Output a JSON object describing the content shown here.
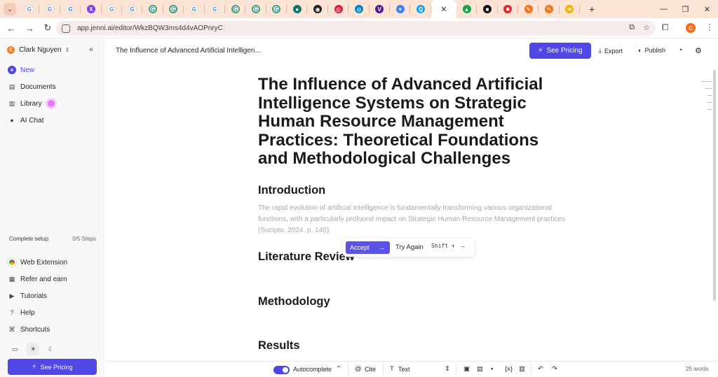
{
  "browser": {
    "tab_menu_glyph": "⌄",
    "tabs": [
      {
        "icon": "google-icon",
        "glyph": "G"
      },
      {
        "icon": "google-icon",
        "glyph": "G"
      },
      {
        "icon": "google-icon",
        "glyph": "G"
      },
      {
        "icon": "purple-x-icon",
        "glyph": "X",
        "color": "#7c3aed"
      },
      {
        "icon": "google-icon",
        "glyph": "G"
      },
      {
        "icon": "google-icon",
        "glyph": "G"
      },
      {
        "icon": "google-ring-icon",
        "glyph": "G"
      },
      {
        "icon": "google-ring-icon",
        "glyph": "G"
      },
      {
        "icon": "google-icon",
        "glyph": "G"
      },
      {
        "icon": "google-icon",
        "glyph": "G"
      },
      {
        "icon": "google-ring-icon",
        "glyph": "G"
      },
      {
        "icon": "google-ring-icon",
        "glyph": "G"
      },
      {
        "icon": "google-ring-icon",
        "glyph": "G"
      },
      {
        "icon": "teal-app-icon",
        "glyph": "●",
        "color": "#0f766e"
      },
      {
        "icon": "dark-app-icon",
        "glyph": "◉",
        "color": "#222222"
      },
      {
        "icon": "pink-app-icon",
        "glyph": "◎",
        "color": "#e11d48"
      },
      {
        "icon": "blue-ring-icon",
        "glyph": "◎",
        "color": "#0284c7"
      },
      {
        "icon": "v-app-icon",
        "glyph": "V",
        "color": "#4c1d95"
      },
      {
        "icon": "jenni-icon",
        "glyph": "✦",
        "color": "#3b82f6"
      },
      {
        "icon": "q-app-icon",
        "glyph": "Q",
        "color": "#0ea5e9"
      }
    ],
    "active_tab_close": "✕",
    "tabs_after": [
      {
        "icon": "green-app-icon",
        "glyph": "▲",
        "color": "#16a34a"
      },
      {
        "icon": "black-square-icon",
        "glyph": "■",
        "color": "#111111"
      },
      {
        "icon": "red-burst-icon",
        "glyph": "✹",
        "color": "#dc2626"
      },
      {
        "icon": "orange-app-icon",
        "glyph": "✎",
        "color": "#f97316"
      },
      {
        "icon": "orange-app-icon",
        "glyph": "✎",
        "color": "#f97316"
      },
      {
        "icon": "yellow-app-icon",
        "glyph": "✉",
        "color": "#eab308"
      }
    ],
    "new_tab_glyph": "+",
    "window_controls": [
      "—",
      "❐",
      "✕"
    ],
    "url": "app.jenni.ai/editor/WkzBQW3ms4d4vAOPnryC",
    "avatar_letter": "C"
  },
  "sidebar": {
    "user_name": "Clark Nguyen",
    "user_initial": "C",
    "collapse_glyph": "«",
    "items": [
      {
        "label": "New",
        "icon": "plus-circle-icon",
        "glyph": "+"
      },
      {
        "label": "Documents",
        "icon": "document-icon",
        "glyph": "▤"
      },
      {
        "label": "Library",
        "icon": "library-icon",
        "glyph": "▥"
      },
      {
        "label": "AI Chat",
        "icon": "chat-bubble-icon",
        "glyph": "●"
      }
    ],
    "setup": {
      "label": "Complete setup",
      "steps": "0/5 Steps"
    },
    "lower_items": [
      {
        "label": "Web Extension",
        "icon": "chrome-icon",
        "glyph": ""
      },
      {
        "label": "Refer and earn",
        "icon": "gift-icon",
        "glyph": "▦"
      },
      {
        "label": "Tutorials",
        "icon": "video-icon",
        "glyph": "▶"
      },
      {
        "label": "Help",
        "icon": "help-circle-icon",
        "glyph": "?"
      },
      {
        "label": "Shortcuts",
        "icon": "command-icon",
        "glyph": "⌘"
      }
    ],
    "theme_glyphs": {
      "monitor": "▭",
      "sun": "☀",
      "moon": "☾"
    },
    "pricing_label": "See Pricing",
    "pricing_glyph": "⚡"
  },
  "toolbar": {
    "doc_title": "The Influence of Advanced Artificial Intelligen...",
    "pricing_label": "See Pricing",
    "pricing_glyph": "⚡",
    "export_label": "Export",
    "export_glyph": "⤓",
    "publish_label": "Publish",
    "publish_glyph": "◐",
    "history_glyph": "◔",
    "settings_glyph": "⚙"
  },
  "document": {
    "title": "The Influence of Advanced Artificial Intelligence Systems on Strategic Human Resource Management Practices: Theoretical Foundations and Methodological Challenges",
    "headings": [
      "Introduction",
      "Literature Review",
      "Methodology",
      "Results"
    ],
    "suggestion": "The rapid evolution of artificial intelligence is fundamentally transforming various organizational functions, with a particularly profound impact on Strategic Human Resource Management practices (Sucipto, 2024, p. 140)."
  },
  "suggestion_bar": {
    "accept_label": "Accept",
    "accept_glyph": "→",
    "try_again_label": "Try Again",
    "shortcut": "Shift +",
    "shortcut_glyph": "→"
  },
  "bottom_bar": {
    "autocomplete_label": "Autocomplete",
    "autocomplete_on": true,
    "caret_glyph": "⌃",
    "cite_label": "Cite",
    "cite_glyph": "@",
    "text_label": "Text",
    "text_glyph": "T",
    "select_glyph": "⇕",
    "insert_glyphs": [
      "▣",
      "▤",
      "▪",
      "{x}",
      "▥"
    ],
    "undo_glyph": "↶",
    "redo_glyph": "↷",
    "word_count": "25 words"
  },
  "colors": {
    "accent": "#5147e6",
    "tab_strip": "#fbe3d6",
    "ghost_text": "#a7a7ad"
  }
}
